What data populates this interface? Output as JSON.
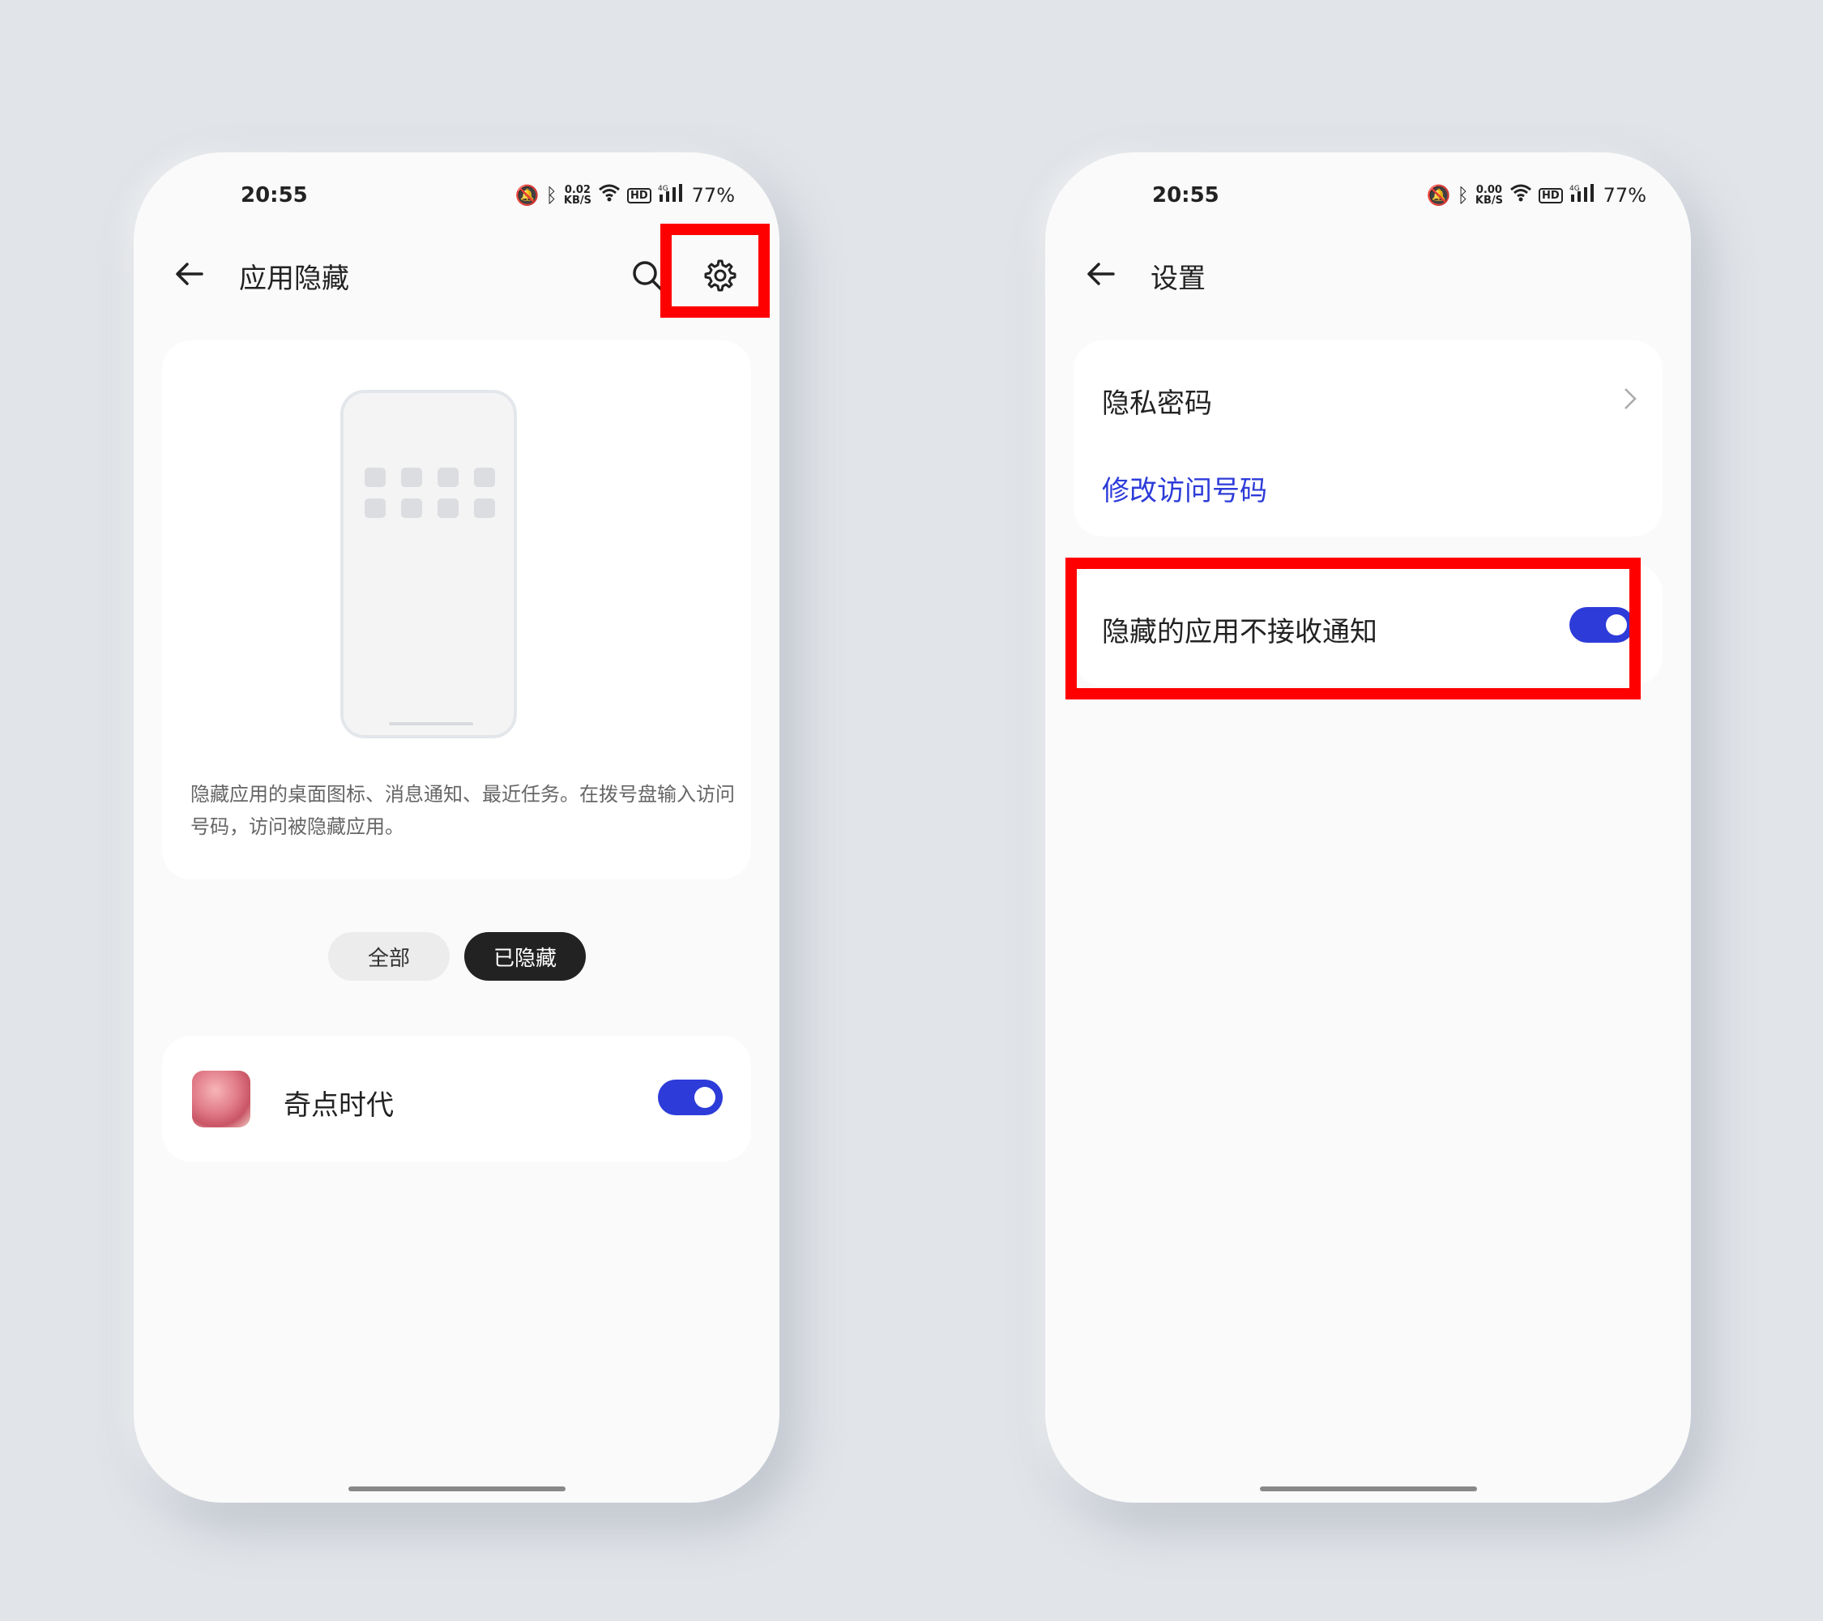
{
  "left": {
    "status": {
      "time": "20:55",
      "speed": "0.02",
      "speed_unit": "KB/S",
      "hd": "HD",
      "network": "4G",
      "battery": "77%"
    },
    "title": "应用隐藏",
    "description": "隐藏应用的桌面图标、消息通知、最近任务。在拨号盘输入访问号码，访问被隐藏应用。",
    "filters": {
      "all": "全部",
      "hidden": "已隐藏"
    },
    "app": {
      "name": "奇点时代",
      "hidden": true
    }
  },
  "right": {
    "status": {
      "time": "20:55",
      "speed": "0.00",
      "speed_unit": "KB/S",
      "hd": "HD",
      "network": "4G",
      "battery": "77%"
    },
    "title": "设置",
    "privacy_password": "隐私密码",
    "change_access_code": "修改访问号码",
    "no_notification_label": "隐藏的应用不接收通知",
    "no_notification_on": true
  },
  "colors": {
    "accent": "#2d3bd9",
    "highlight": "#ff0000"
  }
}
